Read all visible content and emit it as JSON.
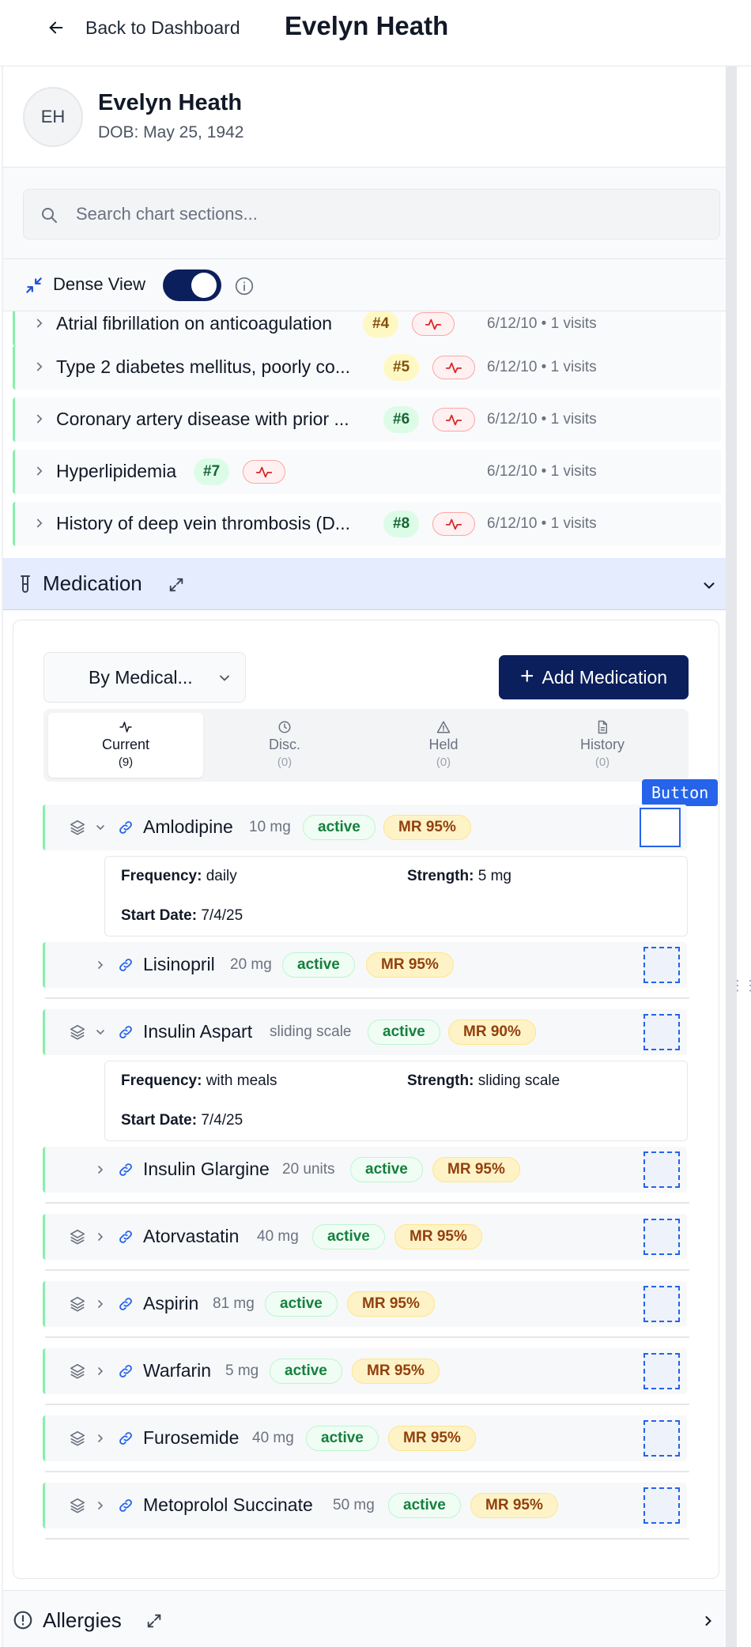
{
  "header": {
    "back_label": "Back to Dashboard",
    "title": "Evelyn Heath"
  },
  "patient": {
    "initials": "EH",
    "name": "Evelyn Heath",
    "dob": "DOB: May 25, 1942"
  },
  "search": {
    "placeholder": "Search chart sections..."
  },
  "dense_view": {
    "label": "Dense View",
    "enabled": true
  },
  "problems": [
    {
      "title": "Atrial fibrillation on anticoagulation",
      "number": "#4",
      "tag_color": "yellow",
      "meta": "6/12/10 • 1 visits"
    },
    {
      "title": "Type 2 diabetes mellitus, poorly co...",
      "number": "#5",
      "tag_color": "yellow",
      "meta": "6/12/10 • 1 visits"
    },
    {
      "title": "Coronary artery disease with prior ...",
      "number": "#6",
      "tag_color": "green",
      "meta": "6/12/10 • 1 visits"
    },
    {
      "title": "Hyperlipidemia",
      "number": "#7",
      "tag_color": "green",
      "meta": "6/12/10 • 1 visits"
    },
    {
      "title": "History of deep vein thrombosis (D...",
      "number": "#8",
      "tag_color": "green",
      "meta": "6/12/10 • 1 visits"
    }
  ],
  "medication": {
    "section_title": "Medication",
    "group_by": "By Medical...",
    "add_label": "Add Medication",
    "tabs": [
      {
        "label": "Current",
        "count": "(9)",
        "icon": "activity-icon"
      },
      {
        "label": "Disc.",
        "count": "(0)",
        "icon": "clock-icon"
      },
      {
        "label": "Held",
        "count": "(0)",
        "icon": "warning-icon"
      },
      {
        "label": "History",
        "count": "(0)",
        "icon": "document-icon"
      }
    ],
    "tooltip": "Button",
    "items": [
      {
        "name": "Amlodipine",
        "dose": "10 mg",
        "status": "active",
        "mr": "MR 95%",
        "expanded": true,
        "details": {
          "frequency_label": "Frequency:",
          "frequency": "daily",
          "strength_label": "Strength:",
          "strength": "5 mg",
          "start_label": "Start Date:",
          "start": "7/4/25"
        }
      },
      {
        "name": "Lisinopril",
        "dose": "20 mg",
        "status": "active",
        "mr": "MR 95%"
      },
      {
        "name": "Insulin Aspart",
        "dose": "sliding scale",
        "status": "active",
        "mr": "MR 90%",
        "expanded": true,
        "details": {
          "frequency_label": "Frequency:",
          "frequency": "with meals",
          "strength_label": "Strength:",
          "strength": "sliding scale",
          "start_label": "Start Date:",
          "start": "7/4/25"
        }
      },
      {
        "name": "Insulin Glargine",
        "dose": "20 units",
        "status": "active",
        "mr": "MR 95%"
      },
      {
        "name": "Atorvastatin",
        "dose": "40 mg",
        "status": "active",
        "mr": "MR 95%"
      },
      {
        "name": "Aspirin",
        "dose": "81 mg",
        "status": "active",
        "mr": "MR 95%"
      },
      {
        "name": "Warfarin",
        "dose": "5 mg",
        "status": "active",
        "mr": "MR 95%"
      },
      {
        "name": "Furosemide",
        "dose": "40 mg",
        "status": "active",
        "mr": "MR 95%"
      },
      {
        "name": "Metoprolol Succinate",
        "dose": "50 mg",
        "status": "active",
        "mr": "MR 95%"
      }
    ]
  },
  "allergies": {
    "section_title": "Allergies"
  }
}
